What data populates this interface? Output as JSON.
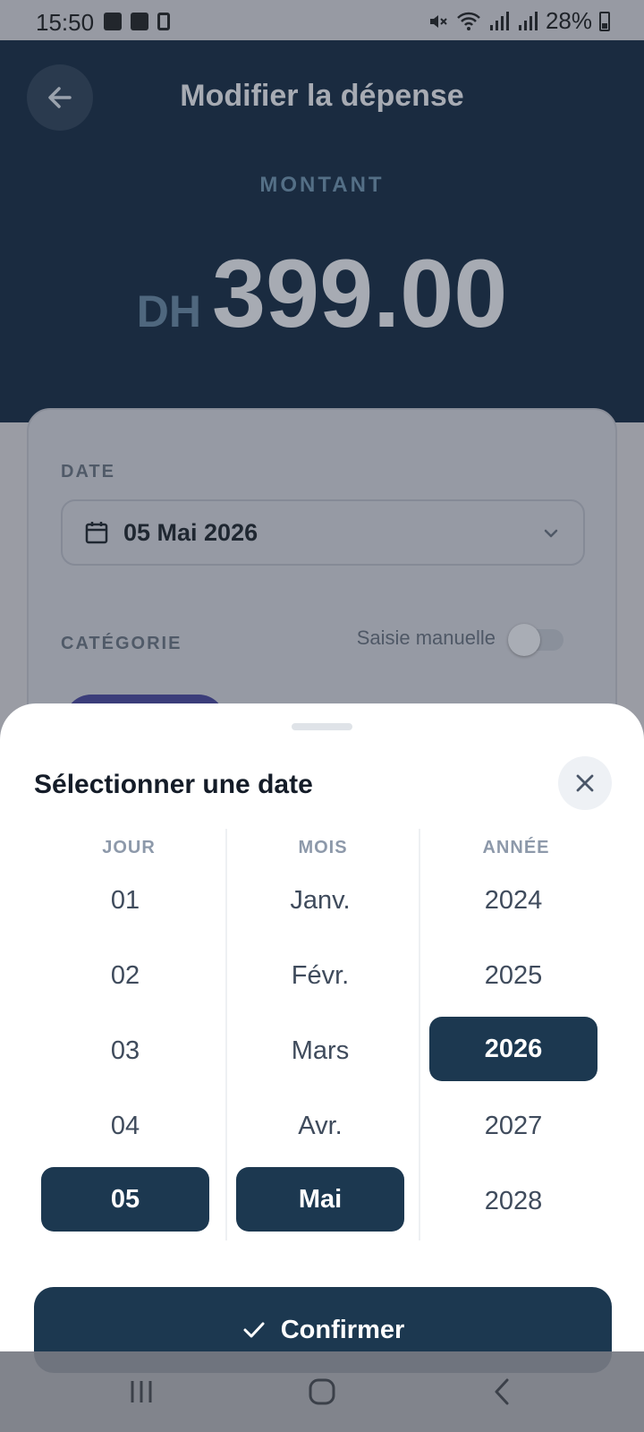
{
  "status_bar": {
    "time": "15:50",
    "battery": "28%"
  },
  "header": {
    "title": "Modifier la dépense",
    "amount_label": "MONTANT",
    "currency": "DH",
    "amount": "399.00"
  },
  "form": {
    "date_label": "DATE",
    "date_value": "05 Mai 2026",
    "category_label": "CATÉGORIE",
    "manual_entry_label": "Saisie manuelle",
    "manual_entry_on": false
  },
  "sheet": {
    "title": "Sélectionner une date",
    "columns": {
      "day": {
        "header": "JOUR",
        "items": [
          "01",
          "02",
          "03",
          "04",
          "05"
        ],
        "selected": "05"
      },
      "month": {
        "header": "MOIS",
        "items": [
          "Janv.",
          "Févr.",
          "Mars",
          "Avr.",
          "Mai"
        ],
        "selected": "Mai"
      },
      "year": {
        "header": "ANNÉE",
        "items": [
          "2024",
          "2025",
          "2026",
          "2027",
          "2028"
        ],
        "selected": "2026"
      }
    },
    "confirm_label": "Confirmer"
  },
  "colors": {
    "header_bg": "#1a2b40",
    "accent": "#1c3850",
    "sheet_bg": "#ffffff"
  },
  "icons": [
    "back-arrow-icon",
    "calendar-icon",
    "chevron-down-icon",
    "close-icon",
    "check-icon",
    "recents-icon",
    "home-icon",
    "nav-back-icon"
  ]
}
